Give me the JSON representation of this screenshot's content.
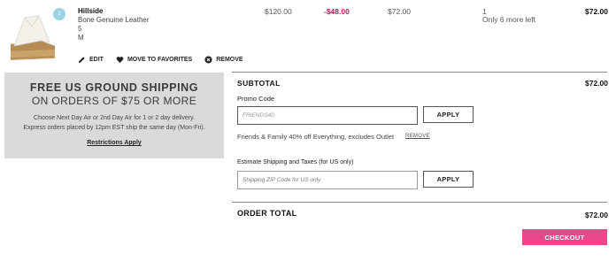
{
  "product": {
    "qty_badge": "1",
    "name": "Hillside",
    "material": "Bone Genuine Leather",
    "size": "5",
    "width": "M",
    "price": "$120.00",
    "discount": "-$48.00",
    "sale_price": "$72.00",
    "quantity": "1",
    "stock_note": "Only 6 more left",
    "line_total": "$72.00",
    "image_icon": "wedge-sandal-image"
  },
  "actions": {
    "edit": "EDIT",
    "favorites": "MOVE TO FAVORITES",
    "remove": "REMOVE"
  },
  "shipping_promo": {
    "line1": "FREE US GROUND SHIPPING",
    "line2": "ON ORDERS OF $75 OR MORE",
    "body1": "Choose Next Day Air or 2nd Day Air for 1 or 2 day delivery.",
    "body2": "Express orders placed by 12pm EST ship the same day (Mon-Fri).",
    "link": "Restrictions Apply"
  },
  "summary": {
    "subtotal_label": "SUBTOTAL",
    "subtotal_value": "$72.00",
    "promo_label": "Promo Code",
    "promo_value": "FRIENDS40",
    "apply_label": "APPLY",
    "promo_applied": "Friends & Family 40% off Everything, excludes Outlet",
    "remove_label": "REMOVE",
    "estimate_label": "Estimate Shipping and Taxes",
    "estimate_note": "(for US only)",
    "zip_placeholder": "Shipping ZIP Code for US only",
    "apply2_label": "APPLY",
    "order_total_label": "ORDER TOTAL",
    "order_total_value": "$72.00",
    "checkout_label": "CHECKOUT"
  },
  "colors": {
    "accent": "#e8488a",
    "discount": "#c2185b",
    "badge": "#9ad3e6",
    "promo_box": "#dadada"
  }
}
